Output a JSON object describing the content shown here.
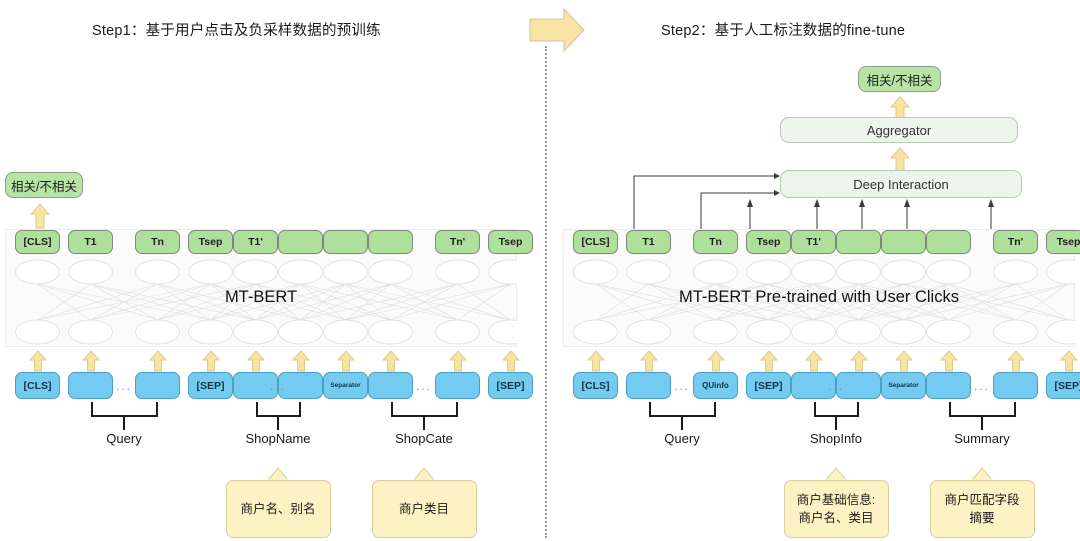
{
  "meta": {
    "colors": {
      "green_badge": "#b7e4a4",
      "green_token": "#aee09b",
      "blue_token": "#74cbf2",
      "yellow_arrow": "#f7e3a1",
      "callout_fill": "#fdf2c4",
      "proc_bar_fill": "#eef5ec",
      "panel_fill": "#fbfbfb"
    }
  },
  "transition_arrow": {
    "icon": "right-block-arrow",
    "direction": "right"
  },
  "divider": {
    "style": "dotted-vertical"
  },
  "left_panel": {
    "title": "Step1：基于用户点击及负采样数据的预训练",
    "output_badge": "相关/不相关",
    "output_arrow_icon": "up-arrow-icon",
    "bert_label": "MT-BERT",
    "output_tokens": [
      {
        "label": "[CLS]"
      },
      {
        "label": "T1"
      },
      {
        "label": "Tn"
      },
      {
        "label": "Tsep"
      },
      {
        "label": "T1'"
      },
      {
        "label": ""
      },
      {
        "label": ""
      },
      {
        "label": ""
      },
      {
        "label": "Tn'"
      },
      {
        "label": "Tsep"
      }
    ],
    "input_tokens": [
      {
        "label": "[CLS]",
        "size": "normal"
      },
      {
        "label": "",
        "size": "normal"
      },
      {
        "label": "",
        "size": "normal"
      },
      {
        "label": "[SEP]",
        "size": "normal"
      },
      {
        "label": "",
        "size": "normal"
      },
      {
        "label": "",
        "size": "normal"
      },
      {
        "label": "Separator",
        "size": "tiny"
      },
      {
        "label": "",
        "size": "normal"
      },
      {
        "label": "",
        "size": "normal"
      },
      {
        "label": "[SEP]",
        "size": "normal"
      }
    ],
    "ellipsis": "...",
    "groups": [
      {
        "label": "Query"
      },
      {
        "label": "ShopName"
      },
      {
        "label": "ShopCate"
      }
    ],
    "callouts": [
      {
        "lines": [
          "商户名、别名"
        ]
      },
      {
        "lines": [
          "商户类目"
        ]
      }
    ]
  },
  "right_panel": {
    "title": "Step2：基于人工标注数据的fine-tune",
    "output_badge": "相关/不相关",
    "output_arrow_icon": "up-arrow-icon",
    "aggregator_label": "Aggregator",
    "aggregator_arrow_icon": "up-arrow-icon",
    "deep_interaction_label": "Deep Interaction",
    "bert_label": "MT-BERT Pre-trained with User Clicks",
    "output_tokens": [
      {
        "label": "[CLS]"
      },
      {
        "label": "T1"
      },
      {
        "label": "Tn"
      },
      {
        "label": "Tsep"
      },
      {
        "label": "T1'"
      },
      {
        "label": ""
      },
      {
        "label": ""
      },
      {
        "label": ""
      },
      {
        "label": "Tn'"
      },
      {
        "label": "Tsep"
      }
    ],
    "input_tokens": [
      {
        "label": "[CLS]",
        "size": "normal"
      },
      {
        "label": "",
        "size": "normal"
      },
      {
        "label": "QUinfo",
        "size": "small"
      },
      {
        "label": "[SEP]",
        "size": "normal"
      },
      {
        "label": "",
        "size": "normal"
      },
      {
        "label": "",
        "size": "normal"
      },
      {
        "label": "Separator",
        "size": "tiny"
      },
      {
        "label": "",
        "size": "normal"
      },
      {
        "label": "",
        "size": "normal"
      },
      {
        "label": "[SEP]",
        "size": "normal"
      }
    ],
    "ellipsis": "...",
    "groups": [
      {
        "label": "Query"
      },
      {
        "label": "ShopInfo"
      },
      {
        "label": "Summary"
      }
    ],
    "callouts": [
      {
        "lines": [
          "商户基础信息:",
          "商户名、类目"
        ]
      },
      {
        "lines": [
          "商户匹配字段",
          "摘要"
        ]
      }
    ]
  }
}
